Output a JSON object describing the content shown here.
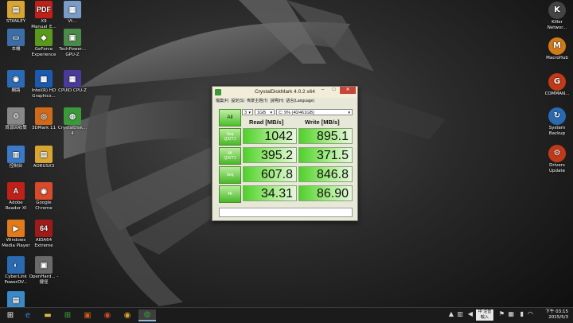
{
  "desktop": {
    "left_icons": [
      {
        "label": "STANLEY",
        "glyph": "▤",
        "color": "#d9a532"
      },
      {
        "label": "X9 Manual_E...",
        "glyph": "PDF",
        "color": "#c0201a"
      },
      {
        "label": "Vt...",
        "glyph": "▦",
        "color": "#7a9cc8"
      },
      {
        "label": "本機",
        "glyph": "▭",
        "color": "#3b6ea8"
      },
      {
        "label": "GeForce Experience",
        "glyph": "◆",
        "color": "#5a9a1a"
      },
      {
        "label": "TechPower... GPU-Z",
        "glyph": "▣",
        "color": "#4a8a4a"
      },
      {
        "label": "網路",
        "glyph": "◉",
        "color": "#2b6ab8"
      },
      {
        "label": "Intel(R) HD Graphics...",
        "glyph": "▩",
        "color": "#1b5ab0"
      },
      {
        "label": "CPUID CPU-Z",
        "glyph": "▦",
        "color": "#4a3a9a"
      },
      {
        "label": "資源回收筒",
        "glyph": "♲",
        "color": "#888888"
      },
      {
        "label": "3DMark 11",
        "glyph": "◎",
        "color": "#d06a1a"
      },
      {
        "label": "CrystalDisk... 4",
        "glyph": "◍",
        "color": "#3a9a3a"
      },
      {
        "label": "控制台",
        "glyph": "▥",
        "color": "#3a7ac8"
      },
      {
        "label": "AORUSX3",
        "glyph": "▤",
        "color": "#d9a532"
      },
      {
        "label": "Adobe Reader XI",
        "glyph": "A",
        "color": "#c0201a"
      },
      {
        "label": "Google Chrome",
        "glyph": "◉",
        "color": "#d84a2a"
      },
      {
        "label": "Windows Media Player",
        "glyph": "▶",
        "color": "#e07a1a"
      },
      {
        "label": "AIDA64 Extreme",
        "glyph": "64",
        "color": "#a01a1a"
      },
      {
        "label": "CyberLink PowerDV...",
        "glyph": "◐",
        "color": "#2a6ab0"
      },
      {
        "label": "OpenHard... - 捷徑",
        "glyph": "▣",
        "color": "#6a6a6a"
      },
      {
        "label": "",
        "glyph": "▤",
        "color": "#3a8ac8"
      }
    ],
    "right_icons": [
      {
        "label": "Killer Networ...",
        "glyph": "K",
        "color": "#444444"
      },
      {
        "label": "MacroHub",
        "glyph": "M",
        "color": "#d07a1a"
      },
      {
        "label": "COMMAN...",
        "glyph": "G",
        "color": "#c03a1a"
      },
      {
        "label": "System Backup",
        "glyph": "↻",
        "color": "#2a6ab0"
      },
      {
        "label": "Drivers Update",
        "glyph": "⚙",
        "color": "#c03a1a"
      }
    ]
  },
  "cdm": {
    "title": "CrystalDiskMark 4.0.2 x64",
    "menu": [
      "檔案(F)",
      "設定(S)",
      "佈景主題(T)",
      "說明(H)",
      "語言(Language)"
    ],
    "all_label": "All",
    "count_value": "3",
    "size_value": "1GB",
    "drive_value": "C: 9% (40/461GB)",
    "read_header": "Read [MB/s]",
    "write_header": "Write [MB/s]",
    "rows": [
      {
        "label_line1": "Seq",
        "label_line2": "Q32T1",
        "read": "1042",
        "write": "895.1"
      },
      {
        "label_line1": "4K",
        "label_line2": "Q32T1",
        "read": "395.2",
        "write": "371.5"
      },
      {
        "label_line1": "Seq",
        "label_line2": "",
        "read": "607.8",
        "write": "846.8"
      },
      {
        "label_line1": "4K",
        "label_line2": "",
        "read": "34.31",
        "write": "86.90"
      }
    ]
  },
  "taskbar": {
    "start_glyph": "⊞",
    "apps": [
      {
        "name": "ie",
        "glyph": "e",
        "color": "#3a8ae0"
      },
      {
        "name": "explorer",
        "glyph": "▬",
        "color": "#e0b84a"
      },
      {
        "name": "store",
        "glyph": "⊞",
        "color": "#3aa83a"
      },
      {
        "name": "media",
        "glyph": "▣",
        "color": "#d05a1a"
      },
      {
        "name": "game",
        "glyph": "◉",
        "color": "#d04a2a"
      },
      {
        "name": "chrome",
        "glyph": "◉",
        "color": "#e0a02a"
      },
      {
        "name": "crystaldisk",
        "glyph": "◍",
        "color": "#3a9a3a"
      }
    ],
    "ime_line1": "中 注音",
    "ime_line2": "輸入",
    "clock_time": "下午 03:15",
    "clock_date": "2015/5/3"
  }
}
